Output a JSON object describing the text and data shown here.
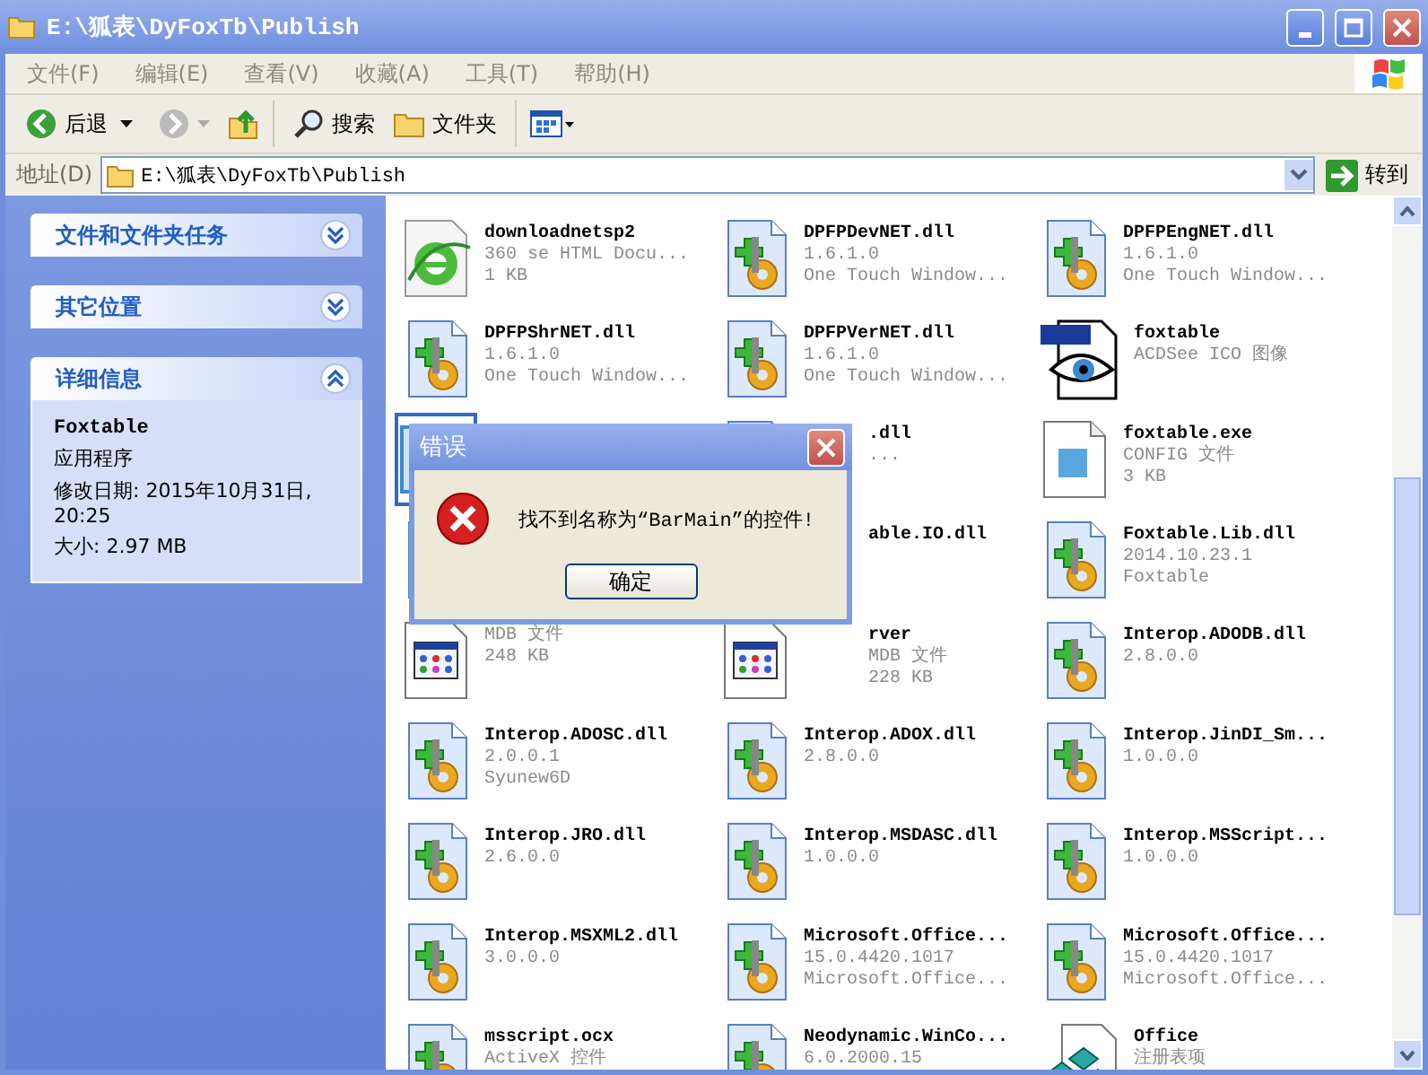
{
  "window": {
    "title": "E:\\狐表\\DyFoxTb\\Publish"
  },
  "menu": [
    "文件(F)",
    "编辑(E)",
    "查看(V)",
    "收藏(A)",
    "工具(T)",
    "帮助(H)"
  ],
  "toolbar": {
    "back": "后退",
    "search": "搜索",
    "folders": "文件夹"
  },
  "address": {
    "label": "地址(D)",
    "value": "E:\\狐表\\DyFoxTb\\Publish",
    "go": "转到"
  },
  "sidebar": [
    {
      "title": "文件和文件夹任务",
      "expanded": false
    },
    {
      "title": "其它位置",
      "expanded": false
    },
    {
      "title": "详细信息",
      "expanded": true,
      "name": "Foxtable",
      "lines": [
        "应用程序",
        "修改日期: 2015年10月31日, 20:25",
        "大小: 2.97 MB"
      ]
    }
  ],
  "files": [
    {
      "kind": "html",
      "name": "downloadnetsp2",
      "lines": [
        "360 se HTML Docu...",
        "1 KB"
      ],
      "selected": false,
      "covered": false
    },
    {
      "kind": "dll",
      "name": "DPFPDevNET.dll",
      "lines": [
        "1.6.1.0",
        "One Touch Window..."
      ],
      "selected": false,
      "covered": false
    },
    {
      "kind": "dll",
      "name": "DPFPEngNET.dll",
      "lines": [
        "1.6.1.0",
        "One Touch Window..."
      ],
      "selected": false,
      "covered": false
    },
    {
      "kind": "dll",
      "name": "DPFPShrNET.dll",
      "lines": [
        "1.6.1.0",
        "One Touch Window..."
      ],
      "selected": false,
      "covered": false
    },
    {
      "kind": "dll",
      "name": "DPFPVerNET.dll",
      "lines": [
        "1.6.1.0",
        "One Touch Window..."
      ],
      "selected": false,
      "covered": false
    },
    {
      "kind": "ico",
      "name": "foxtable",
      "lines": [
        "ACDSee ICO 图像"
      ],
      "selected": false,
      "covered": false
    },
    {
      "kind": "app",
      "selected": true,
      "covered": true
    },
    {
      "kind": "dll",
      "name": ".dll",
      "lines": [
        "..."
      ],
      "selected": false,
      "covered": true
    },
    {
      "kind": "config",
      "name": "foxtable.exe",
      "lines": [
        "CONFIG 文件",
        "3 KB"
      ],
      "selected": false,
      "covered": false
    },
    {
      "kind": "dll",
      "selected": false
    },
    {
      "kind": "dll",
      "name": "able.IO.dll",
      "selected": false,
      "covered": true
    },
    {
      "kind": "dll",
      "name": "Foxtable.Lib.dll",
      "lines": [
        "2014.10.23.1",
        "Foxtable"
      ],
      "selected": false,
      "covered": false
    },
    {
      "kind": "mdb",
      "lines": [
        "MDB 文件",
        "248 KB"
      ],
      "selected": false,
      "covered": false
    },
    {
      "kind": "mdb",
      "name": "rver",
      "lines": [
        "MDB 文件",
        "228 KB"
      ],
      "selected": false,
      "covered": true
    },
    {
      "kind": "dll",
      "name": "Interop.ADODB.dll",
      "lines": [
        "2.8.0.0"
      ],
      "selected": false,
      "covered": false
    },
    {
      "kind": "dll",
      "name": "Interop.ADOSC.dll",
      "lines": [
        "2.0.0.1",
        "Syunew6D"
      ],
      "selected": false,
      "covered": false
    },
    {
      "kind": "dll",
      "name": "Interop.ADOX.dll",
      "lines": [
        "2.8.0.0"
      ],
      "selected": false,
      "covered": false
    },
    {
      "kind": "dll",
      "name": "Interop.JinDI_Sm...",
      "lines": [
        "1.0.0.0"
      ],
      "selected": false,
      "covered": false
    },
    {
      "kind": "dll",
      "name": "Interop.JRO.dll",
      "lines": [
        "2.6.0.0"
      ],
      "selected": false,
      "covered": false
    },
    {
      "kind": "dll",
      "name": "Interop.MSDASC.dll",
      "lines": [
        "1.0.0.0"
      ],
      "selected": false,
      "covered": false
    },
    {
      "kind": "dll",
      "name": "Interop.MSScript...",
      "lines": [
        "1.0.0.0"
      ],
      "selected": false,
      "covered": false
    },
    {
      "kind": "dll",
      "name": "Interop.MSXML2.dll",
      "lines": [
        "3.0.0.0"
      ],
      "selected": false,
      "covered": false
    },
    {
      "kind": "dll",
      "name": "Microsoft.Office...",
      "lines": [
        "15.0.4420.1017",
        "Microsoft.Office..."
      ],
      "selected": false,
      "covered": false
    },
    {
      "kind": "dll",
      "name": "Microsoft.Office...",
      "lines": [
        "15.0.4420.1017",
        "Microsoft.Office..."
      ],
      "selected": false,
      "covered": false
    },
    {
      "kind": "dll",
      "name": "msscript.ocx",
      "lines": [
        "ActiveX 控件"
      ],
      "selected": false,
      "covered": false
    },
    {
      "kind": "dll",
      "name": "Neodynamic.WinCo...",
      "lines": [
        "6.0.2000.15"
      ],
      "selected": false,
      "covered": false
    },
    {
      "kind": "reg",
      "name": "Office",
      "lines": [
        "注册表项"
      ],
      "selected": false,
      "covered": false
    }
  ],
  "dialog": {
    "title": "错误",
    "message": "找不到名称为“BarMain”的控件!",
    "button": "确定"
  }
}
